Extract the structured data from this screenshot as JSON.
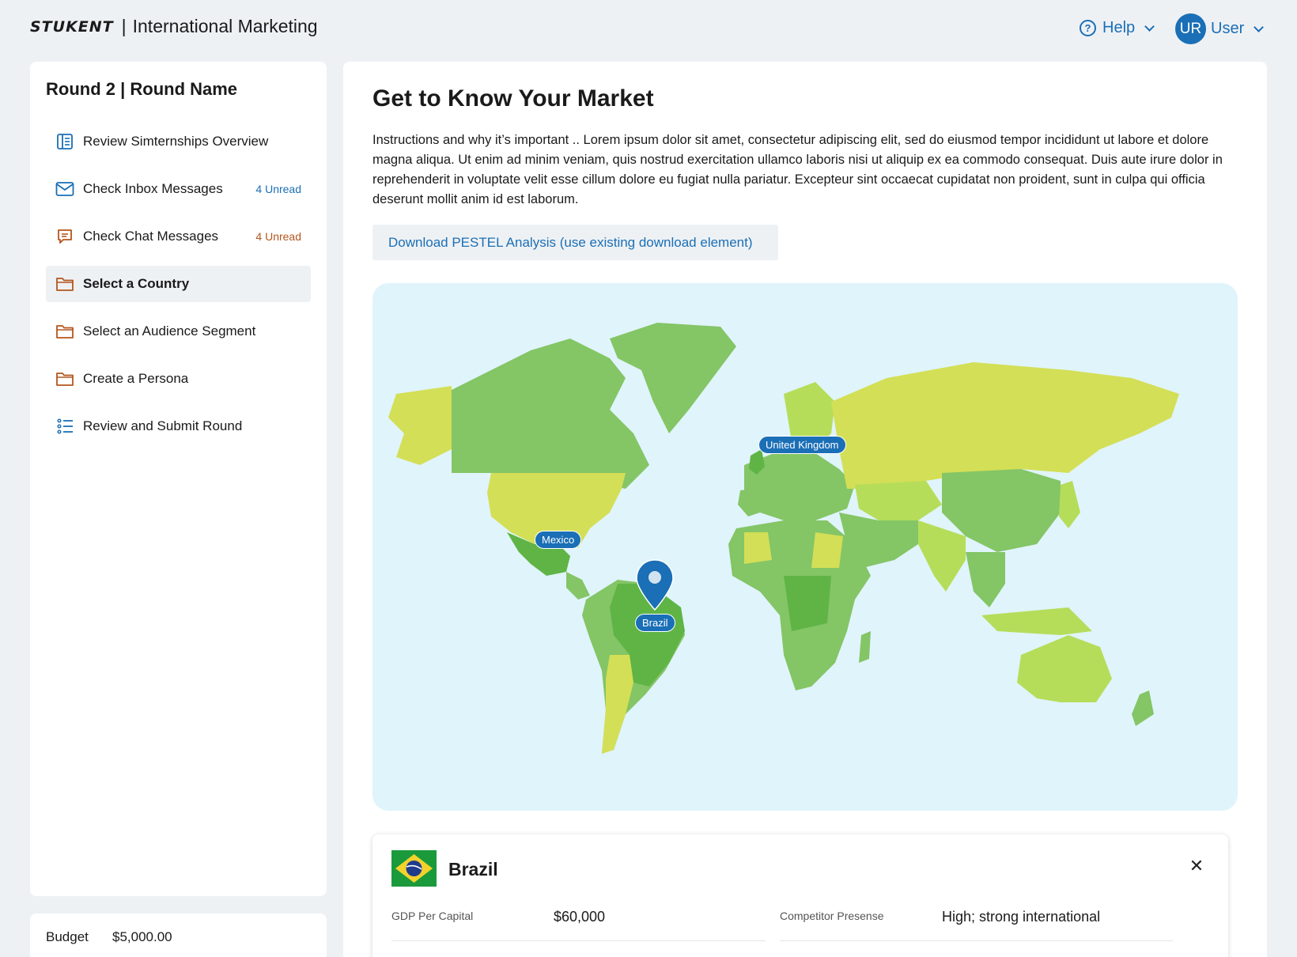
{
  "header": {
    "logo": "STUKENT",
    "separator": "|",
    "app_title": "International Marketing",
    "help_label": "Help",
    "user_initials": "UR",
    "user_label": "User"
  },
  "sidebar": {
    "round_title": "Round 2 | Round Name",
    "items": [
      {
        "label": "Review Simternships Overview",
        "icon": "book-icon",
        "badge": ""
      },
      {
        "label": "Check Inbox Messages",
        "icon": "mail-icon",
        "badge": "4 Unread"
      },
      {
        "label": "Check Chat Messages",
        "icon": "chat-icon",
        "badge": "4 Unread"
      },
      {
        "label": "Select a Country",
        "icon": "folder-icon",
        "badge": "",
        "active": true
      },
      {
        "label": "Select an Audience Segment",
        "icon": "folder-icon",
        "badge": ""
      },
      {
        "label": "Create a Persona",
        "icon": "folder-icon",
        "badge": ""
      },
      {
        "label": "Review and Submit Round",
        "icon": "list-icon",
        "badge": ""
      }
    ],
    "budget_label": "Budget",
    "budget_value": "$5,000.00"
  },
  "main": {
    "title": "Get to Know Your Market",
    "intro": "Instructions and why it’s important .. Lorem ipsum dolor sit amet, consectetur adipiscing elit, sed do eiusmod tempor incididunt ut labore et dolore magna aliqua. Ut enim ad minim veniam, quis nostrud exercitation ullamco laboris nisi ut aliquip ex ea commodo consequat. Duis aute irure dolor in reprehenderit in voluptate velit esse cillum dolore eu fugiat nulla pariatur. Excepteur sint occaecat cupidatat non proident, sunt in culpa qui officia deserunt mollit anim id est laborum.",
    "download_label": "Download PESTEL Analysis (use existing download element)"
  },
  "map": {
    "labels": {
      "uk": "United Kingdom",
      "mexico": "Mexico",
      "brazil": "Brazil"
    },
    "selected": "Brazil"
  },
  "country_card": {
    "name": "Brazil",
    "stats": [
      {
        "label": "GDP Per Capital",
        "value": "$60,000"
      },
      {
        "label": "Competitor Presense",
        "value": "High; strong international"
      }
    ]
  },
  "colors": {
    "accent": "#1a6fb6",
    "badge_inbox": "#1a6fb6",
    "badge_chat": "#b4561d",
    "folder_icon": "#b4561d",
    "map_water": "#e0f4fb"
  }
}
